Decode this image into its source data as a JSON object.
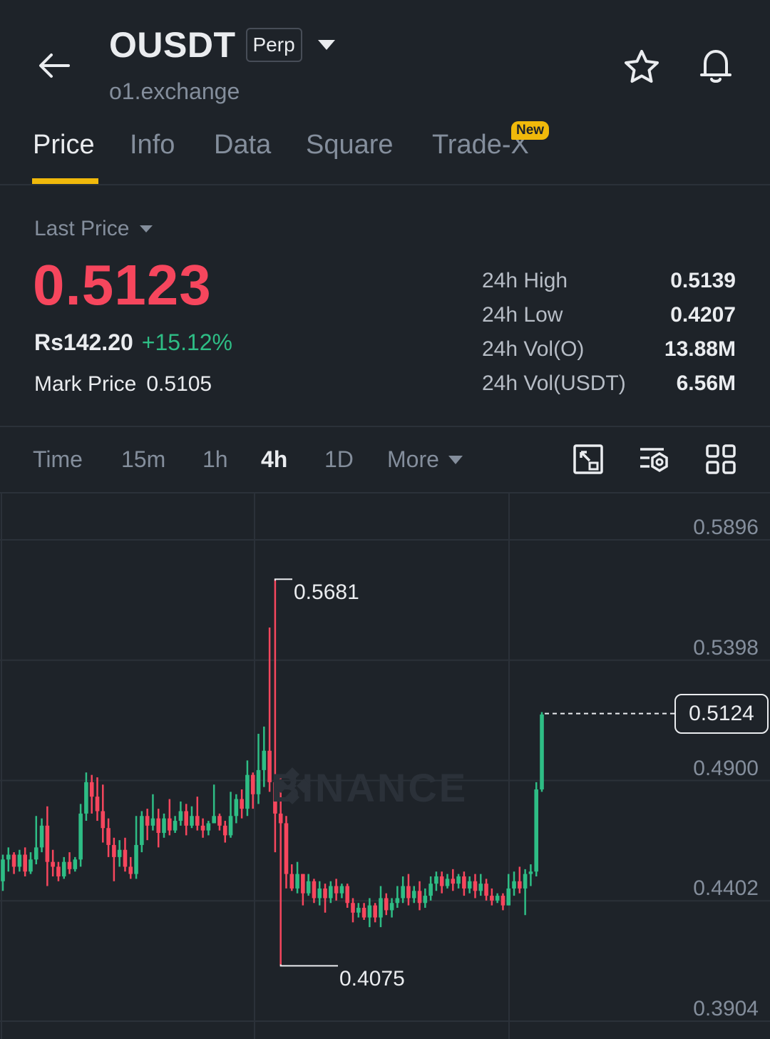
{
  "header": {
    "symbol": "OUSDT",
    "badge": "Perp",
    "exchange": "o1.exchange"
  },
  "icons": [
    "back-arrow-icon",
    "chevron-down-icon",
    "star-icon",
    "bell-icon"
  ],
  "tabs": [
    {
      "label": "Price",
      "active": true
    },
    {
      "label": "Info"
    },
    {
      "label": "Data"
    },
    {
      "label": "Square"
    },
    {
      "label": "Trade-X",
      "badge": "New"
    }
  ],
  "price": {
    "label": "Last Price",
    "last": "0.5123",
    "fiat": "Rs142.20",
    "change": "+15.12%",
    "mark_label": "Mark Price",
    "mark_value": "0.5105"
  },
  "stats": [
    {
      "label": "24h High",
      "value": "0.5139"
    },
    {
      "label": "24h Low",
      "value": "0.4207"
    },
    {
      "label": "24h Vol(O)",
      "value": "13.88M"
    },
    {
      "label": "24h Vol(USDT)",
      "value": "6.56M"
    }
  ],
  "intervals": {
    "items": [
      "Time",
      "15m",
      "1h",
      "4h",
      "1D"
    ],
    "active": "4h",
    "more": "More"
  },
  "colors": {
    "up": "#2ebd85",
    "down": "#f6465d",
    "accent": "#f0b90b",
    "bg": "#1e2329"
  },
  "chart_data": {
    "type": "candlestick",
    "y_ticks": [
      "0.5896",
      "0.5398",
      "0.4900",
      "0.4402",
      "0.3904"
    ],
    "ylim": [
      0.3904,
      0.5896
    ],
    "last_price_tag": "0.5124",
    "high_marker": "0.5681",
    "low_marker": "0.4075",
    "watermark": "BINANCE",
    "candles": [
      [
        0.443,
        0.452,
        0.439,
        0.454
      ],
      [
        0.452,
        0.454,
        0.447,
        0.457
      ],
      [
        0.454,
        0.449,
        0.446,
        0.455
      ],
      [
        0.449,
        0.454,
        0.447,
        0.456
      ],
      [
        0.454,
        0.447,
        0.445,
        0.457
      ],
      [
        0.447,
        0.452,
        0.446,
        0.455
      ],
      [
        0.452,
        0.457,
        0.45,
        0.47
      ],
      [
        0.457,
        0.466,
        0.455,
        0.469
      ],
      [
        0.466,
        0.451,
        0.441,
        0.474
      ],
      [
        0.451,
        0.449,
        0.445,
        0.456
      ],
      [
        0.449,
        0.445,
        0.443,
        0.451
      ],
      [
        0.445,
        0.451,
        0.444,
        0.453
      ],
      [
        0.451,
        0.448,
        0.446,
        0.455
      ],
      [
        0.448,
        0.452,
        0.447,
        0.453
      ],
      [
        0.452,
        0.471,
        0.449,
        0.475
      ],
      [
        0.471,
        0.484,
        0.468,
        0.488
      ],
      [
        0.484,
        0.478,
        0.471,
        0.487
      ],
      [
        0.478,
        0.472,
        0.468,
        0.486
      ],
      [
        0.472,
        0.465,
        0.459,
        0.483
      ],
      [
        0.465,
        0.458,
        0.453,
        0.469
      ],
      [
        0.458,
        0.453,
        0.443,
        0.461
      ],
      [
        0.453,
        0.456,
        0.449,
        0.46
      ],
      [
        0.456,
        0.449,
        0.447,
        0.461
      ],
      [
        0.449,
        0.446,
        0.444,
        0.453
      ],
      [
        0.446,
        0.458,
        0.444,
        0.47
      ],
      [
        0.458,
        0.47,
        0.455,
        0.472
      ],
      [
        0.47,
        0.466,
        0.46,
        0.473
      ],
      [
        0.466,
        0.469,
        0.464,
        0.479
      ],
      [
        0.469,
        0.463,
        0.457,
        0.473
      ],
      [
        0.463,
        0.469,
        0.461,
        0.471
      ],
      [
        0.469,
        0.464,
        0.462,
        0.477
      ],
      [
        0.464,
        0.468,
        0.463,
        0.47
      ],
      [
        0.468,
        0.472,
        0.466,
        0.476
      ],
      [
        0.472,
        0.466,
        0.462,
        0.475
      ],
      [
        0.466,
        0.47,
        0.465,
        0.474
      ],
      [
        0.47,
        0.466,
        0.464,
        0.478
      ],
      [
        0.466,
        0.464,
        0.461,
        0.469
      ],
      [
        0.464,
        0.467,
        0.462,
        0.468
      ],
      [
        0.467,
        0.47,
        0.467,
        0.483
      ],
      [
        0.47,
        0.466,
        0.464,
        0.471
      ],
      [
        0.466,
        0.462,
        0.459,
        0.468
      ],
      [
        0.462,
        0.47,
        0.461,
        0.48
      ],
      [
        0.47,
        0.477,
        0.467,
        0.479
      ],
      [
        0.477,
        0.473,
        0.469,
        0.481
      ],
      [
        0.473,
        0.487,
        0.47,
        0.493
      ],
      [
        0.487,
        0.479,
        0.473,
        0.488
      ],
      [
        0.479,
        0.489,
        0.475,
        0.504
      ],
      [
        0.489,
        0.497,
        0.482,
        0.507
      ],
      [
        0.497,
        0.484,
        0.48,
        0.548
      ],
      [
        0.484,
        0.471,
        0.455,
        0.568
      ],
      [
        0.471,
        0.467,
        0.408,
        0.487
      ],
      [
        0.467,
        0.446,
        0.44,
        0.47
      ],
      [
        0.446,
        0.44,
        0.439,
        0.45
      ],
      [
        0.44,
        0.446,
        0.438,
        0.451
      ],
      [
        0.446,
        0.438,
        0.433,
        0.446
      ],
      [
        0.438,
        0.443,
        0.437,
        0.446
      ],
      [
        0.443,
        0.436,
        0.434,
        0.444
      ],
      [
        0.436,
        0.44,
        0.433,
        0.443
      ],
      [
        0.44,
        0.436,
        0.43,
        0.442
      ],
      [
        0.436,
        0.441,
        0.434,
        0.443
      ],
      [
        0.441,
        0.438,
        0.435,
        0.444
      ],
      [
        0.438,
        0.441,
        0.436,
        0.442
      ],
      [
        0.441,
        0.434,
        0.432,
        0.442
      ],
      [
        0.434,
        0.43,
        0.426,
        0.436
      ],
      [
        0.43,
        0.432,
        0.428,
        0.434
      ],
      [
        0.432,
        0.428,
        0.427,
        0.434
      ],
      [
        0.428,
        0.433,
        0.424,
        0.436
      ],
      [
        0.433,
        0.428,
        0.426,
        0.434
      ],
      [
        0.428,
        0.436,
        0.424,
        0.441
      ],
      [
        0.436,
        0.431,
        0.429,
        0.438
      ],
      [
        0.431,
        0.434,
        0.428,
        0.436
      ],
      [
        0.434,
        0.436,
        0.432,
        0.441
      ],
      [
        0.436,
        0.441,
        0.434,
        0.445
      ],
      [
        0.441,
        0.436,
        0.433,
        0.446
      ],
      [
        0.436,
        0.439,
        0.434,
        0.441
      ],
      [
        0.439,
        0.434,
        0.431,
        0.443
      ],
      [
        0.434,
        0.437,
        0.432,
        0.44
      ],
      [
        0.437,
        0.442,
        0.435,
        0.445
      ],
      [
        0.442,
        0.445,
        0.439,
        0.447
      ],
      [
        0.445,
        0.441,
        0.438,
        0.447
      ],
      [
        0.441,
        0.444,
        0.44,
        0.446
      ],
      [
        0.444,
        0.442,
        0.439,
        0.448
      ],
      [
        0.442,
        0.445,
        0.44,
        0.446
      ],
      [
        0.445,
        0.44,
        0.437,
        0.447
      ],
      [
        0.44,
        0.443,
        0.438,
        0.445
      ],
      [
        0.443,
        0.439,
        0.436,
        0.446
      ],
      [
        0.439,
        0.442,
        0.437,
        0.446
      ],
      [
        0.442,
        0.437,
        0.435,
        0.444
      ],
      [
        0.437,
        0.435,
        0.433,
        0.44
      ],
      [
        0.435,
        0.437,
        0.434,
        0.438
      ],
      [
        0.437,
        0.433,
        0.431,
        0.438
      ],
      [
        0.433,
        0.44,
        0.433,
        0.446
      ],
      [
        0.44,
        0.443,
        0.437,
        0.447
      ],
      [
        0.443,
        0.44,
        0.438,
        0.449
      ],
      [
        0.44,
        0.446,
        0.429,
        0.448
      ],
      [
        0.446,
        0.447,
        0.441,
        0.45
      ],
      [
        0.447,
        0.481,
        0.445,
        0.484
      ],
      [
        0.481,
        0.512,
        0.48,
        0.513
      ]
    ]
  }
}
